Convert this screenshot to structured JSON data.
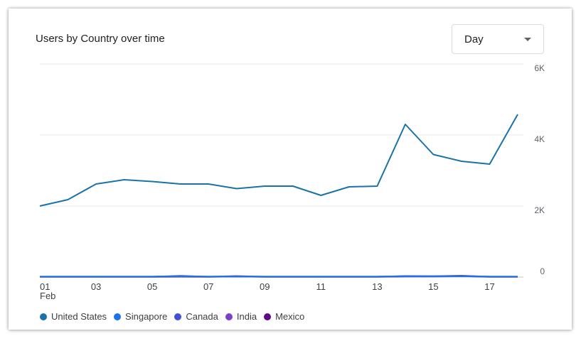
{
  "card": {
    "title": "Users by Country over time"
  },
  "dropdown": {
    "selected": "Day"
  },
  "chart_data": {
    "type": "line",
    "x": [
      "01",
      "02",
      "03",
      "04",
      "05",
      "06",
      "07",
      "08",
      "09",
      "10",
      "11",
      "12",
      "13",
      "14",
      "15",
      "16",
      "17",
      "18"
    ],
    "x_tick_labels": [
      "01",
      "03",
      "05",
      "07",
      "09",
      "11",
      "13",
      "15",
      "17"
    ],
    "x_sublabel": "Feb",
    "y_tick_labels": [
      "0",
      "2K",
      "4K",
      "6K"
    ],
    "ylim": [
      0,
      6000
    ],
    "yticks": [
      0,
      2000,
      4000,
      6000
    ],
    "grid": true,
    "legend_position": "bottom-left",
    "series": [
      {
        "name": "United States",
        "color": "#1a73a8",
        "values": [
          2000,
          2180,
          2620,
          2740,
          2690,
          2620,
          2620,
          2490,
          2560,
          2560,
          2300,
          2540,
          2560,
          4300,
          3450,
          3260,
          3180,
          4580
        ]
      },
      {
        "name": "Singapore",
        "color": "#1a73e8",
        "values": [
          15,
          15,
          15,
          15,
          15,
          20,
          15,
          15,
          15,
          15,
          15,
          15,
          15,
          20,
          20,
          20,
          15,
          15
        ]
      },
      {
        "name": "Canada",
        "color": "#3f51d6",
        "values": [
          10,
          10,
          10,
          10,
          10,
          35,
          10,
          10,
          10,
          10,
          10,
          10,
          10,
          30,
          25,
          30,
          10,
          10
        ]
      },
      {
        "name": "India",
        "color": "#7b3fd0",
        "values": [
          10,
          10,
          10,
          10,
          10,
          20,
          10,
          30,
          10,
          10,
          10,
          10,
          10,
          25,
          25,
          40,
          10,
          10
        ]
      },
      {
        "name": "Mexico",
        "color": "#5c0a8a",
        "values": [
          5,
          5,
          5,
          5,
          5,
          10,
          5,
          15,
          5,
          5,
          5,
          5,
          5,
          15,
          15,
          25,
          5,
          5
        ]
      }
    ]
  }
}
